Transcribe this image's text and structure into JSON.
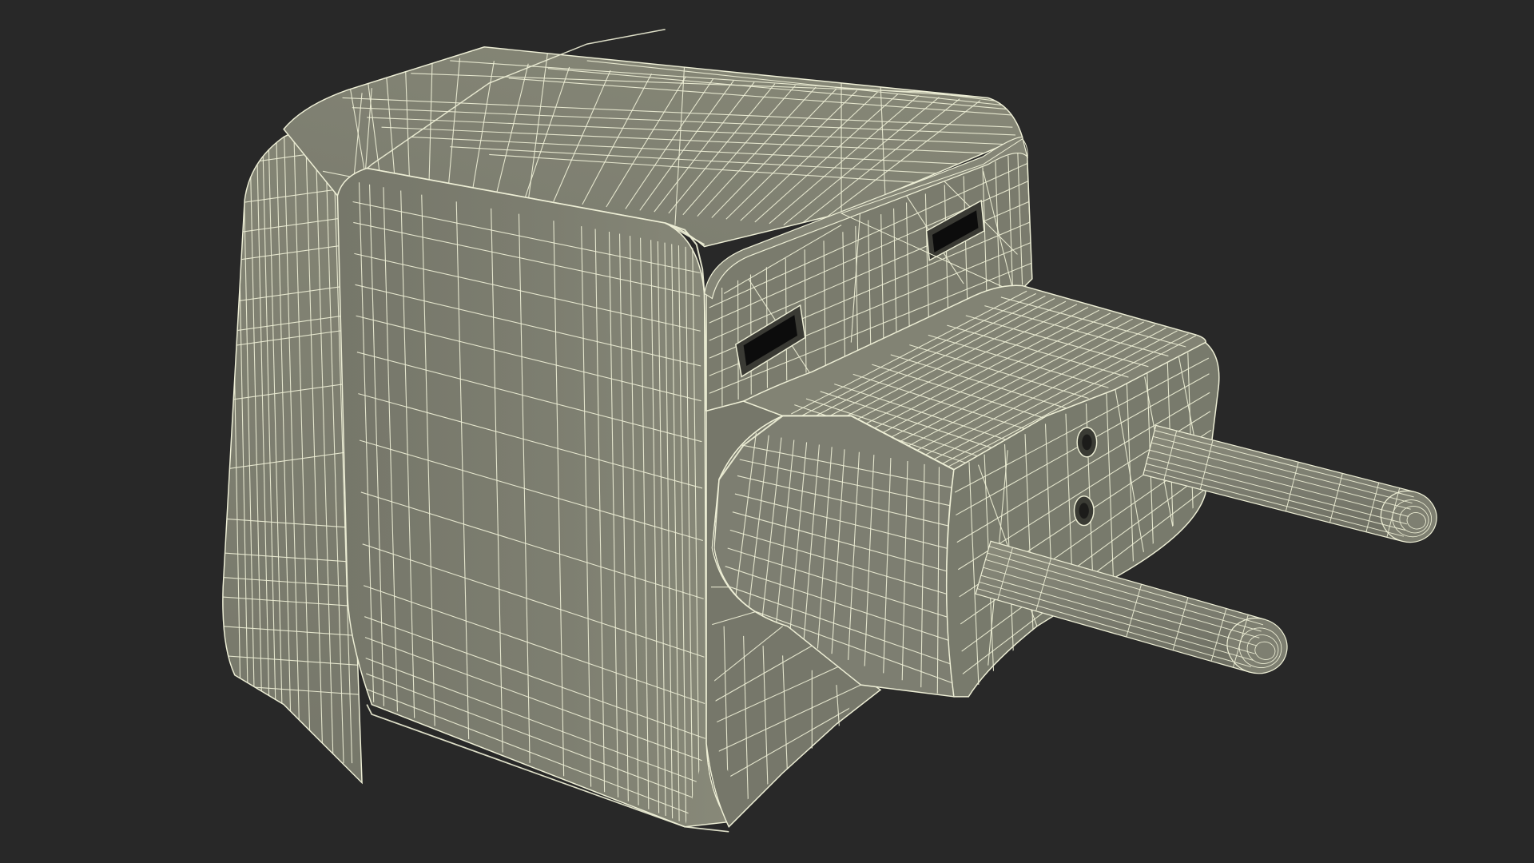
{
  "scene": {
    "subject": "plug-adapter-wireframe",
    "background_color": "#282828",
    "surface_color": "#7b7c6f",
    "surface_dark_color": "#6e6f63",
    "surface_light_color": "#878878",
    "wire_color": "#eeefd6",
    "slot_color": "#0c0c0c",
    "slot_edge_color": "#3a3a34"
  }
}
